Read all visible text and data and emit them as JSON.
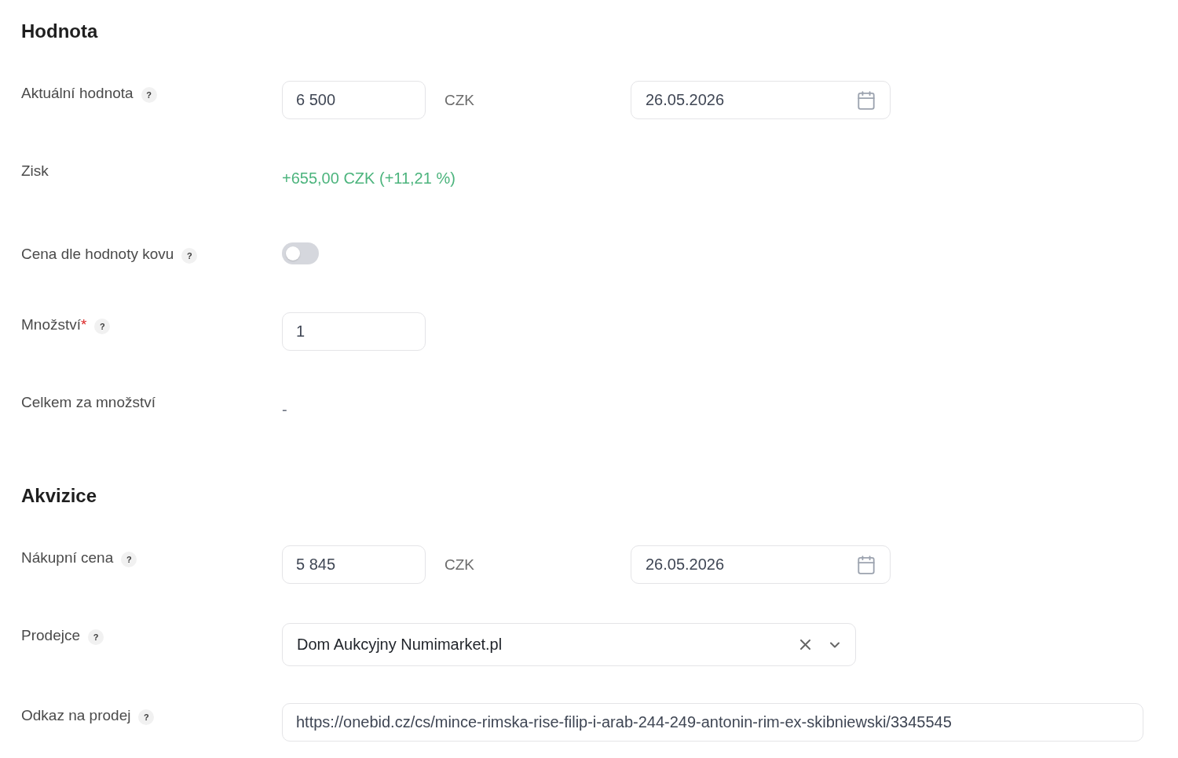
{
  "sections": [
    {
      "title": "Hodnota",
      "fields": [
        {
          "kind": "amount_date",
          "label": "Aktuální hodnota",
          "help": "?",
          "value": "6 500",
          "unit": "CZK",
          "date": "26.05.2026"
        },
        {
          "kind": "display",
          "label": "Zisk",
          "value": "+655,00 CZK (+11,21 %)",
          "positive": true
        },
        {
          "kind": "toggle",
          "label": "Cena dle hodnoty kovu",
          "help": "?",
          "on": false
        },
        {
          "kind": "input",
          "label": "Množství",
          "required_mark": "*",
          "help": "?",
          "value": "1"
        },
        {
          "kind": "display",
          "label": "Celkem za množství",
          "value": "-",
          "positive": false
        }
      ]
    },
    {
      "title": "Akvizice",
      "fields": [
        {
          "kind": "amount_date",
          "label": "Nákupní cena",
          "help": "?",
          "value": "5 845",
          "unit": "CZK",
          "date": "26.05.2026"
        },
        {
          "kind": "select",
          "label": "Prodejce",
          "help": "?",
          "value": "Dom Aukcyjny Numimarket.pl",
          "clearable": true
        },
        {
          "kind": "url",
          "label": "Odkaz na prodej",
          "help": "?",
          "value": "https://onebid.cz/cs/mince-rimska-rise-filip-i-arab-244-249-antonin-rim-ex-skibniewski/3345545"
        }
      ]
    }
  ]
}
